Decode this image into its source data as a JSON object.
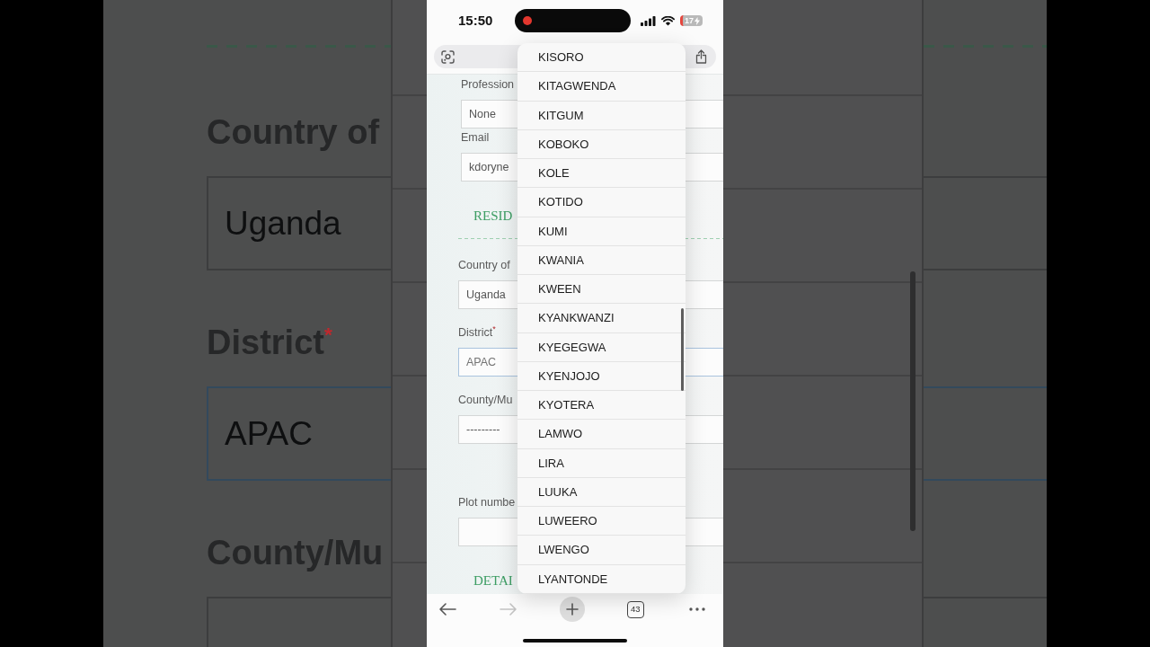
{
  "backdrop": {
    "fields": [
      {
        "label": "Country of",
        "value": "Uganda",
        "focused": false
      },
      {
        "label": "District$^{*}$",
        "value": "APAC",
        "focused": true
      },
      {
        "label": "County/Mu",
        "focused": false
      }
    ]
  },
  "status_bar": {
    "time": "15:50",
    "recording": true,
    "battery": "17",
    "charging": true
  },
  "form": {
    "sections": [
      {
        "fields": [
          {
            "label": "Profession",
            "value": "None",
            "focused": false
          },
          {
            "label": "Email",
            "value": "kdoryne",
            "focused": false
          }
        ]
      },
      {
        "heading": "RESID",
        "fields": [
          {
            "label": "Country of",
            "value": "Uganda",
            "focused": false
          },
          {
            "label": "District$^{*}$",
            "value": "APAC",
            "focused": true
          },
          {
            "label": "County/Mu",
            "value": "---------",
            "focused": false
          },
          {
            "label": "Plot numbe",
            "focused": false
          }
        ]
      },
      {
        "heading": "DETAI"
      }
    ]
  },
  "dropdown": {
    "options": [
      {
        "label": "KISORO",
        "selected": false
      },
      {
        "label": "KITAGWENDA",
        "selected": false
      },
      {
        "label": "KITGUM",
        "selected": false
      },
      {
        "label": "KOBOKO",
        "selected": false
      },
      {
        "label": "KOLE",
        "selected": false
      },
      {
        "label": "KOTIDO",
        "selected": false
      },
      {
        "label": "KUMI",
        "selected": false
      },
      {
        "label": "KWANIA",
        "selected": false
      },
      {
        "label": "KWEEN",
        "selected": false
      },
      {
        "label": "KYANKWANZI",
        "selected": false
      },
      {
        "label": "KYEGEGWA",
        "selected": false
      },
      {
        "label": "KYENJOJO",
        "selected": false
      },
      {
        "label": "KYOTERA",
        "selected": false
      },
      {
        "label": "LAMWO",
        "selected": false
      },
      {
        "label": "LIRA",
        "selected": false
      },
      {
        "label": "LUUKA",
        "selected": false
      },
      {
        "label": "LUWEERO",
        "selected": false
      },
      {
        "label": "LWENGO",
        "selected": false
      },
      {
        "label": "LYANTONDE",
        "selected": false
      }
    ]
  },
  "toolbar": {
    "buttons": [
      {
        "kind": "back",
        "disabled": false
      },
      {
        "kind": "forward",
        "disabled": true
      },
      {
        "kind": "new_tab",
        "disabled": false
      },
      {
        "kind": "tabs",
        "count": "43",
        "disabled": false
      },
      {
        "kind": "more",
        "disabled": false
      }
    ]
  }
}
